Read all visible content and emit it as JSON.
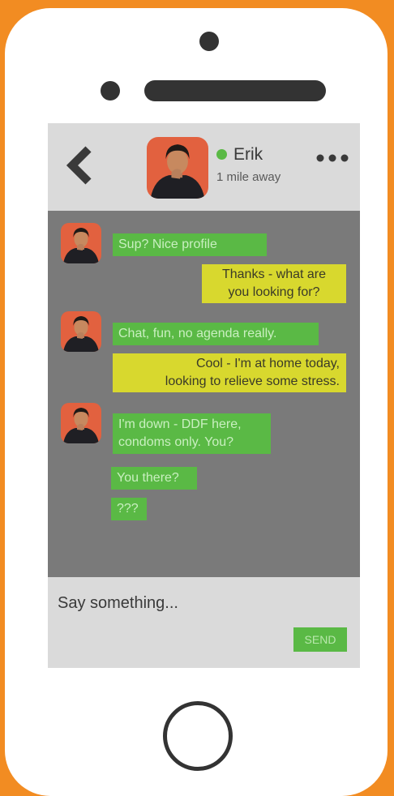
{
  "header": {
    "contact_name": "Erik",
    "distance": "1 mile away",
    "online": true
  },
  "messages": [
    {
      "from": "contact",
      "lines": [
        "Sup? Nice profile"
      ]
    },
    {
      "from": "me",
      "lines": [
        "Thanks - what are",
        "you looking for?"
      ]
    },
    {
      "from": "contact",
      "lines": [
        "Chat, fun, no agenda really."
      ]
    },
    {
      "from": "me",
      "lines": [
        "Cool - I'm at home today,",
        "looking to relieve some stress."
      ]
    },
    {
      "from": "contact",
      "lines": [
        "I'm down - DDF here,",
        "condoms only. You?"
      ]
    },
    {
      "from": "contact",
      "lines": [
        "You there?"
      ]
    },
    {
      "from": "contact",
      "lines": [
        "???"
      ]
    }
  ],
  "composer": {
    "placeholder": "Say something...",
    "send_label": "SEND"
  },
  "colors": {
    "frame_orange": "#f28c22",
    "incoming_bubble": "#5ab945",
    "outgoing_bubble": "#d8d82e",
    "chat_background": "#7a7a7a",
    "bar_background": "#dadada"
  },
  "icons": [
    "back-chevron-icon",
    "more-dots-icon",
    "online-status-icon"
  ]
}
